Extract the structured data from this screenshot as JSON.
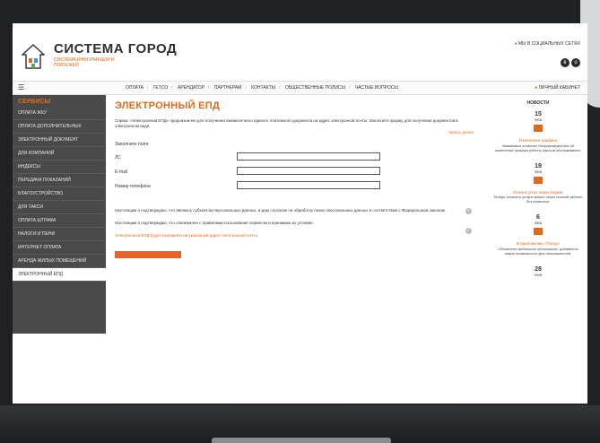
{
  "header": {
    "title": "СИСТЕМА ГОРОД",
    "subtitle": "СИСТЕМА ИНФОРМАЦИИ И ПЛАТЕЖЕЙ",
    "social_link": "МЫ В СОЦИАЛЬНЫХ СЕТЯХ"
  },
  "nav": {
    "items": [
      "ОПЛАТА",
      "ГЕТСО",
      "АРЕНДАТОР",
      "ПАРТНЕРАМ",
      "КОНТАКТЫ",
      "ОБЩЕСТВЕННЫЕ ПОЛИСЫ",
      "ЧАСТЫЕ ВОПРОСЫ"
    ],
    "right": "ЛИЧНЫЙ КАБИНЕТ"
  },
  "sidebar": {
    "title": "СЕРВИСЫ",
    "items": [
      "ОПЛАТА ЖКУ",
      "ОПЛАТА ДОПОЛНИТЕЛЬНЫХ",
      "ЭЛЕКТРОННЫЙ ДОКУМЕНТ",
      "ДЛЯ КОМПАНИЙ",
      "ИНДЕКСЫ",
      "ПЕРЕДАЧА ПОКАЗАНИЙ",
      "БЛАГОУСТРОЙСТВО",
      "ДЛЯ ТАКСИ",
      "ОПЛАТА ШТРАФА",
      "НАЛОГИ И ПЕНИ",
      "ИНТЕРНЕТ ОПЛАТА",
      "АРЕНДА ЖИЛЫХ ПОМЕЩЕНИЙ",
      "ЭЛЕКТРОННЫЙ ЕПД"
    ],
    "active_index": 12
  },
  "main": {
    "title": "ЭЛЕКТРОННЫЙ ЕПД",
    "intro": "Сервис «Электронный ЕПД» предназначен для получения ежемесячного единого платежного документа на адрес электронной почты. Заполните форму для получения документов в электронном виде.",
    "more_link": "Читать далее",
    "form_caption": "Заполните поля:",
    "fields": [
      {
        "label": "ЛС"
      },
      {
        "label": "E-mail"
      },
      {
        "label": "Номер телефона"
      }
    ],
    "consent_1": "Настоящим я подтверждаю, что являюсь субъектом персональных данных, и даю согласие на обработку своих персональных данных в соответствии с Федеральным законом.",
    "consent_2": "Настоящим я подтверждаю, что ознакомлен с правилами пользования сервисом и принимаю их условия.",
    "consent_link": "Электронный ЕПД будет направлен на указанный адрес электронной почты"
  },
  "news": {
    "title": "НОВОСТИ",
    "items": [
      {
        "day": "15",
        "month": "ФЕВ",
        "head": "Изменение графика",
        "body": "Уважаемые клиенты! Информируем вас об изменении графика работы офисов обслуживания."
      },
      {
        "day": "19",
        "month": "ФЕВ",
        "head": "Оплата услуг через сервис",
        "body": "Теперь оплатить услуги можно через личный кабинет без комиссии."
      },
      {
        "day": "6",
        "month": "ФЕВ",
        "head": "В приложении «Город»",
        "body": "Обновлено мобильное приложение, добавлены новые возможности для пользователей."
      },
      {
        "day": "28",
        "month": "ЯНВ",
        "head": "",
        "body": ""
      }
    ]
  }
}
